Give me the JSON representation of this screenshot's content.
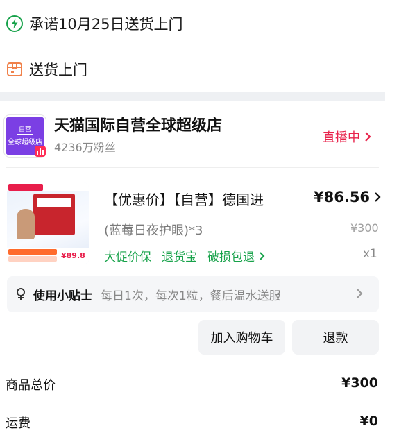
{
  "delivery_promise": "承诺10月25日送货上门",
  "delivery_method": "送货上门",
  "shop": {
    "logo_line1": "自营",
    "logo_line2": "全球超级店",
    "name": "天猫国际自营全球超级店",
    "fans": "4236万粉丝",
    "live_label": "直播中"
  },
  "product": {
    "title": "【优惠价】【自营】德国进",
    "price": "¥86.56",
    "subtitle": "(蓝莓日夜护眼)*3",
    "original_price": "¥300",
    "tags": [
      "大促价保",
      "退货宝",
      "破损包退"
    ],
    "quantity": "x1",
    "image_price": "¥89.8"
  },
  "tips": {
    "label": "使用小贴士",
    "text": "每日1次，每次1粒，餐后温水送服"
  },
  "actions": {
    "add_to_cart": "加入购物车",
    "refund": "退款"
  },
  "summary": [
    {
      "label": "商品总价",
      "value": "¥300"
    },
    {
      "label": "运费",
      "value": "¥0"
    }
  ],
  "colors": {
    "accent_green": "#17a24a",
    "live_red": "#e8254d",
    "delivery_orange": "#f0814a",
    "shop_purple": "#7b3fe4"
  },
  "icons": [
    "lightning-icon",
    "package-icon",
    "live-badge-icon",
    "chevron-right-icon",
    "tips-icon"
  ]
}
